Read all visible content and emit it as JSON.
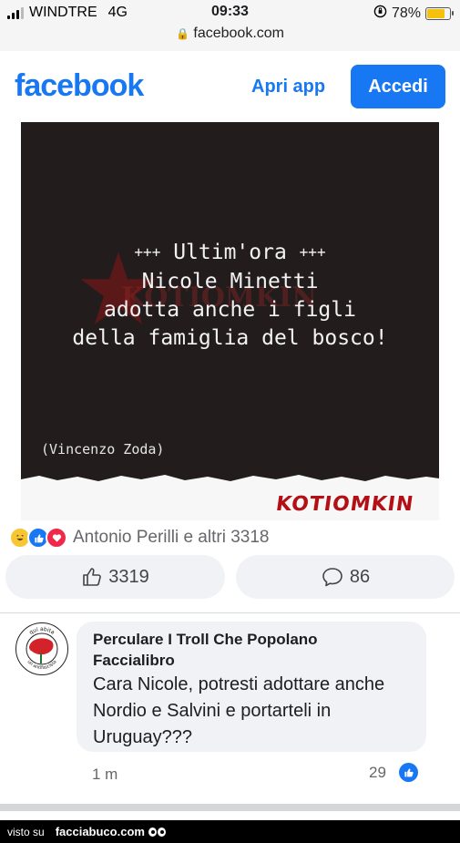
{
  "status_bar": {
    "carrier": "WINDTRE",
    "network": "4G",
    "time": "09:33",
    "battery": "78%",
    "battery_level": 0.78,
    "url": "facebook.com"
  },
  "header": {
    "logo": "facebook",
    "open_app": "Apri app",
    "login": "Accedi"
  },
  "post": {
    "image": {
      "headline_markers": "+++",
      "headline": "Ultim'ora",
      "lines": [
        "Nicole Minetti",
        "adotta anche i figli",
        "della famiglia del bosco!"
      ],
      "author": "(Vincenzo Zoda)",
      "brand": "KOTIOMKIN"
    },
    "reactions": {
      "icons": [
        "haha-icon",
        "like-icon",
        "love-icon"
      ],
      "text": "Antonio Perilli e altri 3318"
    },
    "like_count": "3319",
    "comment_count": "86"
  },
  "comment": {
    "avatar_text_top": "qui abita",
    "avatar_text_bottom": "un antifascista",
    "author": "Perculare I Troll Che Popolano Faccialibro",
    "text": "Cara Nicole, potresti adottare anche Nordio e Salvini e portarteli in Uruguay???",
    "time": "1 m",
    "likes": "29"
  },
  "footer": {
    "visto_su": "visto su",
    "site": "facciabuco.com"
  },
  "colors": {
    "facebook_blue": "#1877f2",
    "post_background": "#221c1d",
    "brand_red": "#b30f14"
  }
}
